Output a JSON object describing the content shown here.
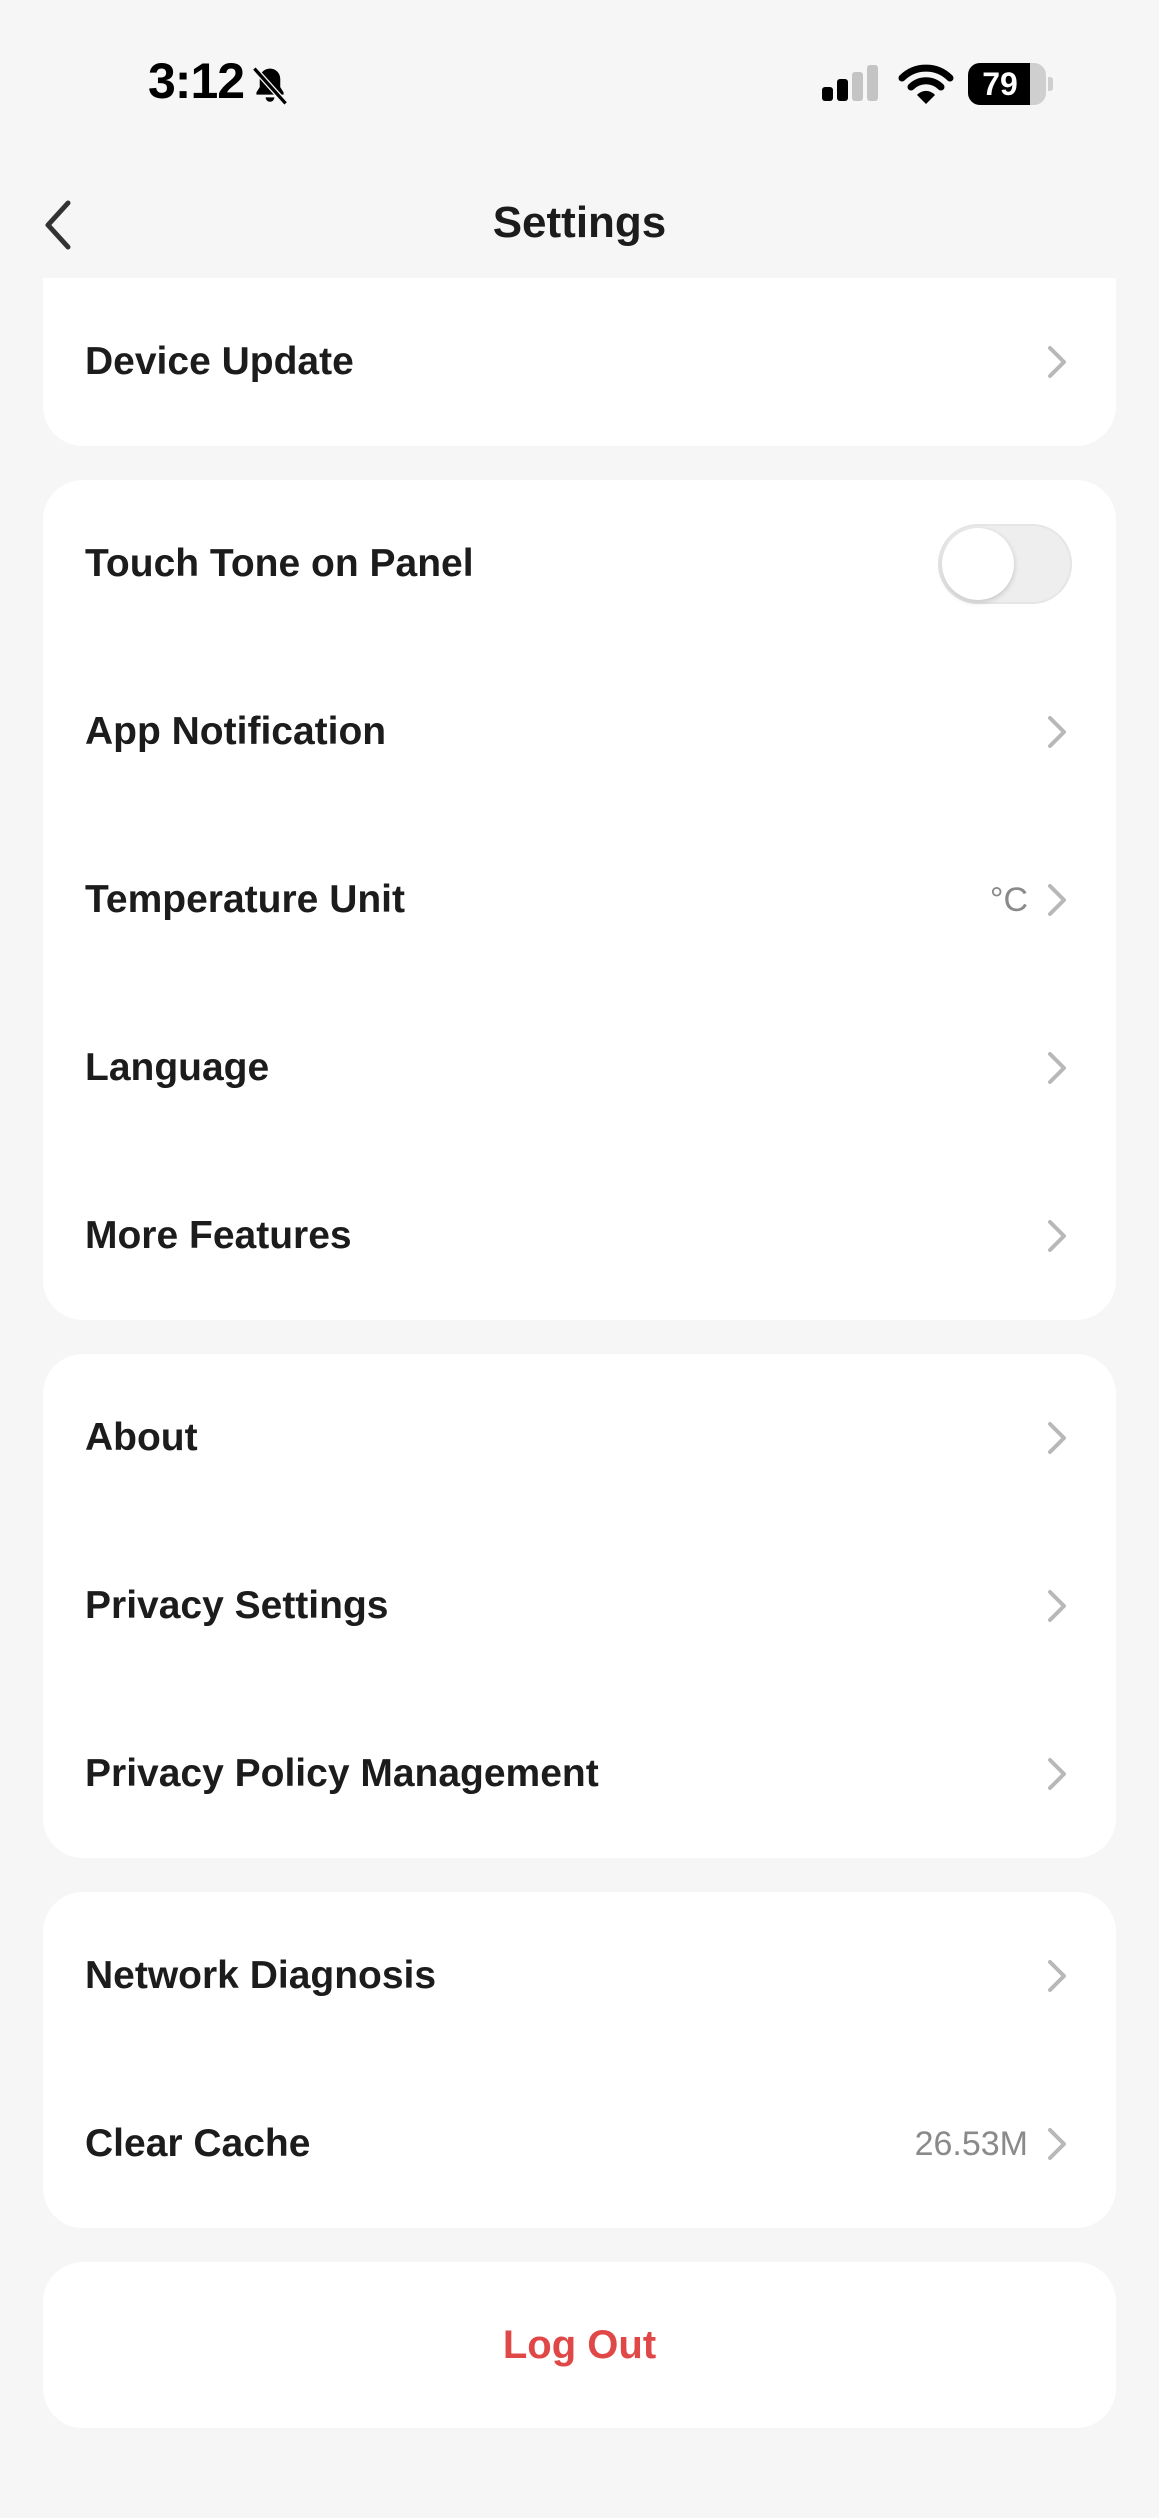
{
  "status_bar": {
    "time": "3:12",
    "battery_level": "79",
    "battery_fraction": 0.79
  },
  "nav": {
    "title": "Settings",
    "back_icon": "chevron-left-icon"
  },
  "groups": {
    "device": {
      "items": [
        {
          "label": "Device Update",
          "value": "",
          "icon": "chevron-right-icon"
        }
      ]
    },
    "preferences": {
      "items": [
        {
          "label": "Touch Tone on Panel",
          "toggle_on": false
        },
        {
          "label": "App Notification",
          "value": "",
          "icon": "chevron-right-icon"
        },
        {
          "label": "Temperature Unit",
          "value": "°C",
          "icon": "chevron-right-icon"
        },
        {
          "label": "Language",
          "value": "",
          "icon": "chevron-right-icon"
        },
        {
          "label": "More Features",
          "value": "",
          "icon": "chevron-right-icon"
        }
      ]
    },
    "about": {
      "items": [
        {
          "label": "About",
          "value": "",
          "icon": "chevron-right-icon"
        },
        {
          "label": "Privacy Settings",
          "value": "",
          "icon": "chevron-right-icon"
        },
        {
          "label": "Privacy Policy Management",
          "value": "",
          "icon": "chevron-right-icon"
        }
      ]
    },
    "maintenance": {
      "items": [
        {
          "label": "Network Diagnosis",
          "value": "",
          "icon": "chevron-right-icon"
        },
        {
          "label": "Clear Cache",
          "value": "26.53M",
          "icon": "chevron-right-icon"
        }
      ]
    }
  },
  "logout": {
    "label": "Log Out"
  },
  "colors": {
    "background": "#f6f6f6",
    "card": "#ffffff",
    "text": "#1c1c1c",
    "secondary_text": "#8a8a8a",
    "chevron": "#b8b8b8",
    "destructive": "#e04848"
  }
}
